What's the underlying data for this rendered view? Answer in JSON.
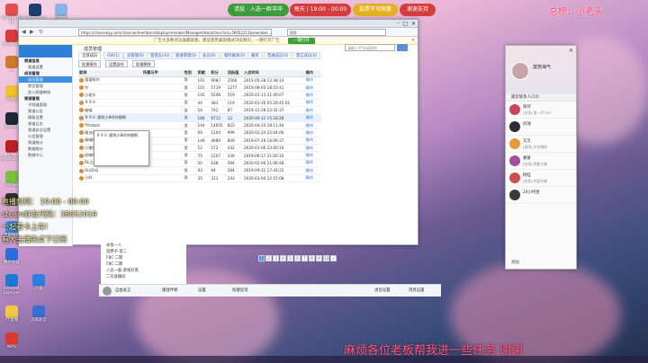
{
  "stream_overlay": {
    "btn_1": "请投 · 入选一群冲冲",
    "btn_2": "每天 | 19:00 - 00:00",
    "btn_3": "投票不可限量",
    "btn_4": "谢谢支持",
    "total_rank": "总榜：小老头",
    "schedule": "直播时间： 19:00 - 00:00",
    "steam_code": "steam好友代码：38052019",
    "line_3": "一起看卡上车!",
    "line_4": "有大主播的点下订阅",
    "bottom_banner": "麻烦各位老板帮我进一些任务 谢谢"
  },
  "desktop_icons": [
    {
      "label": "12345小游戏",
      "color": "#e34d4d"
    },
    {
      "label": "Photoshop",
      "color": "#1b3f6b"
    },
    {
      "label": "回收站",
      "color": "#8ab4e6"
    },
    {
      "label": "WeGame",
      "color": "#d93a3a"
    },
    {
      "label": "Ai",
      "color": "#d0782a"
    },
    {
      "label": "YY语音",
      "color": "#f0c231"
    },
    {
      "label": "Steam",
      "color": "#1b2838"
    },
    {
      "label": "MSI Afterburner",
      "color": "#b82020"
    },
    {
      "label": "YYLive",
      "color": "#7bc242"
    },
    {
      "label": "OBS",
      "color": "#2d2d2d"
    },
    {
      "label": "百度网盘",
      "color": "#3a8ee6"
    },
    {
      "label": "腾讯会议",
      "color": "#2d6de0"
    },
    {
      "label": "Internet Explorer",
      "color": "#1d79d6"
    },
    {
      "label": "迅雷",
      "color": "#2c7fe0"
    },
    {
      "label": "YY直播",
      "color": "#f2c744"
    },
    {
      "label": "迅雷影音",
      "color": "#3a6dd6"
    },
    {
      "label": "WPS",
      "color": "#d83a30"
    }
  ],
  "browser": {
    "url": "https://channelyy.com/channel/members/display/member/ManagerInteraction?sid=56052211&member...",
    "search_placeholder": "搜索",
    "notice": "广告大多数浏览器都能看，建议使用兼容模式浏览网页，一键打开广告",
    "notice_btn": "一键打开"
  },
  "sidebar": {
    "items": [
      {
        "label": "频道信息",
        "kind": "sec"
      },
      {
        "label": "频道设置",
        "kind": "item"
      },
      {
        "label": "成员管理",
        "kind": "sec"
      },
      {
        "label": "成员管理",
        "kind": "active"
      },
      {
        "label": "禁言管理",
        "kind": "item"
      },
      {
        "label": "加入频道审核",
        "kind": "item"
      },
      {
        "label": "频道管理",
        "kind": "sec"
      },
      {
        "label": "子频道管理",
        "kind": "item"
      },
      {
        "label": "频道公告",
        "kind": "item"
      },
      {
        "label": "模板设置",
        "kind": "item"
      },
      {
        "label": "频道日志",
        "kind": "item"
      },
      {
        "label": "频道安全设置",
        "kind": "item"
      },
      {
        "label": "公会管理",
        "kind": "item"
      },
      {
        "label": "频道统计",
        "kind": "item"
      },
      {
        "label": "数据统计",
        "kind": "item"
      },
      {
        "label": "数据中心",
        "kind": "item"
      }
    ]
  },
  "page": {
    "heading": "成员管理",
    "tabs": [
      "全部成员",
      "OW(1)",
      "总管理(6)",
      "管理员(43)",
      "频道管理(0)",
      "会员(0)",
      "临时嘉宾(0)",
      "嘉宾",
      "普通成员(0)",
      "禁言成员(0)"
    ],
    "search_placeholder": "请输入YY号或昵称",
    "toolbar": [
      "批量操作",
      "设置身份",
      "批量删除"
    ]
  },
  "table": {
    "headers": [
      "昵称",
      "所属马甲",
      "性别",
      "贡献",
      "积分",
      "活跃值",
      "入会时间",
      "操作"
    ],
    "rows": [
      {
        "name": "溜溜纸巾",
        "vest": "",
        "sex": "男",
        "contrib": "191",
        "points": "9087",
        "active": "2566",
        "joined": "2015-05-28 12:38:10",
        "op": "操作"
      },
      {
        "name": "令",
        "vest": "",
        "sex": "男",
        "contrib": "101",
        "points": "5719",
        "active": "1277",
        "joined": "2019-08-03 18:53:41",
        "op": "操作"
      },
      {
        "name": "小老头",
        "vest": "",
        "sex": "男",
        "contrib": "145",
        "points": "5248",
        "active": "519",
        "joined": "2020-01-13 21:49:07",
        "op": "操作"
      },
      {
        "name": "９９８",
        "vest": "",
        "sex": "女",
        "contrib": "44",
        "points": "483",
        "active": "119",
        "joined": "2020-03-26 05:29:45:01",
        "op": "操作"
      },
      {
        "name": "喵喵",
        "vest": "",
        "sex": "女",
        "contrib": "54",
        "points": "742",
        "active": "87",
        "joined": "2019-12-28 22:32:37",
        "op": "操作"
      },
      {
        "name": "９９８ 遇到小B呗你捆啊",
        "vest": "",
        "sex": "女",
        "contrib": "184",
        "points": "6712",
        "active": "12",
        "joined": "2020-06-12 15:18:28",
        "op": "操作"
      },
      {
        "name": "*Protect",
        "vest": "",
        "sex": "女",
        "contrib": "244",
        "points": "14655",
        "active": "822",
        "joined": "2020-04-24 18:11:40",
        "op": "操作"
      },
      {
        "name": "政治经融不服群",
        "vest": "",
        "sex": "男",
        "contrib": "69",
        "points": "1204",
        "active": "999",
        "joined": "2020-02-24 22:04:00",
        "op": "操作"
      },
      {
        "name": "喵喵的天天天《不不容》",
        "vest": "",
        "sex": "男",
        "contrib": "149",
        "points": "4889",
        "active": "809",
        "joined": "2019-07-29 16:09:37",
        "op": "操作"
      },
      {
        "name": "小猪猪猪",
        "vest": "",
        "sex": "男",
        "contrib": "52",
        "points": "572",
        "active": "432",
        "joined": "2020-01-06 23:00:16",
        "op": "操作"
      },
      {
        "name": "初晓晓二",
        "vest": "",
        "sex": "男",
        "contrib": "70",
        "points": "1207",
        "active": "339",
        "joined": "2019-06-17 21:00:10",
        "op": "操作"
      },
      {
        "name": "RL之战",
        "vest": "",
        "sex": "男",
        "contrib": "50",
        "points": "638",
        "active": "594",
        "joined": "2020-02-06 21:06:48",
        "op": "操作"
      },
      {
        "name": "OniOnij",
        "vest": "",
        "sex": "男",
        "contrib": "93",
        "points": "94",
        "active": "284",
        "joined": "2019-09-11 17:43:22",
        "op": "操作"
      },
      {
        "name": "小轩",
        "vest": "",
        "sex": "男",
        "contrib": "35",
        "points": "311",
        "active": "243",
        "joined": "2020-03-04 22:15:08",
        "op": "操作"
      }
    ],
    "pager": [
      "1",
      "2",
      "3",
      "4",
      "5",
      "6",
      "7",
      "8",
      "9",
      "10",
      "»"
    ]
  },
  "tooltip": {
    "text": "９９８ 遇到小B呗你捆啊"
  },
  "channel_tree": [
    "永恒一人",
    "反野子·弟二",
    "FBC·二期",
    "FBC·二期",
    "人员一般·游戏开黑",
    "二号直播间"
  ],
  "channel_bar": {
    "items": [
      "自由发言",
      "播放伴奏",
      "设置",
      "按键说话",
      "语音设置",
      "消息设置"
    ]
  },
  "contact_panel": {
    "title": "富丽海气",
    "section_1": "最近联系人(10)",
    "contacts": [
      {
        "name": "保持",
        "status": "[在线] 第一代TOP",
        "color": "#c9435a"
      },
      {
        "name": "风蚀",
        "status": "",
        "color": "#2d2d2d"
      },
      {
        "name": "叉叉",
        "status": "[离线] 空白咖啡",
        "color": "#e59a3b"
      },
      {
        "name": "蒙蒙",
        "status": "[在线] 明星大咖",
        "color": "#a04f9e"
      },
      {
        "name": "柳桂",
        "status": "[在线] 华夏先锋",
        "color": "#d24e4e"
      },
      {
        "name": "24小时星",
        "status": "",
        "color": "#3b3b3b"
      }
    ],
    "bottom_label": "添加"
  },
  "colors": {
    "accent": "#2f7fd8",
    "banner_green": "#3a9c3a",
    "banner_red": "#d53c3c",
    "banner_yellow": "#e3b020"
  }
}
